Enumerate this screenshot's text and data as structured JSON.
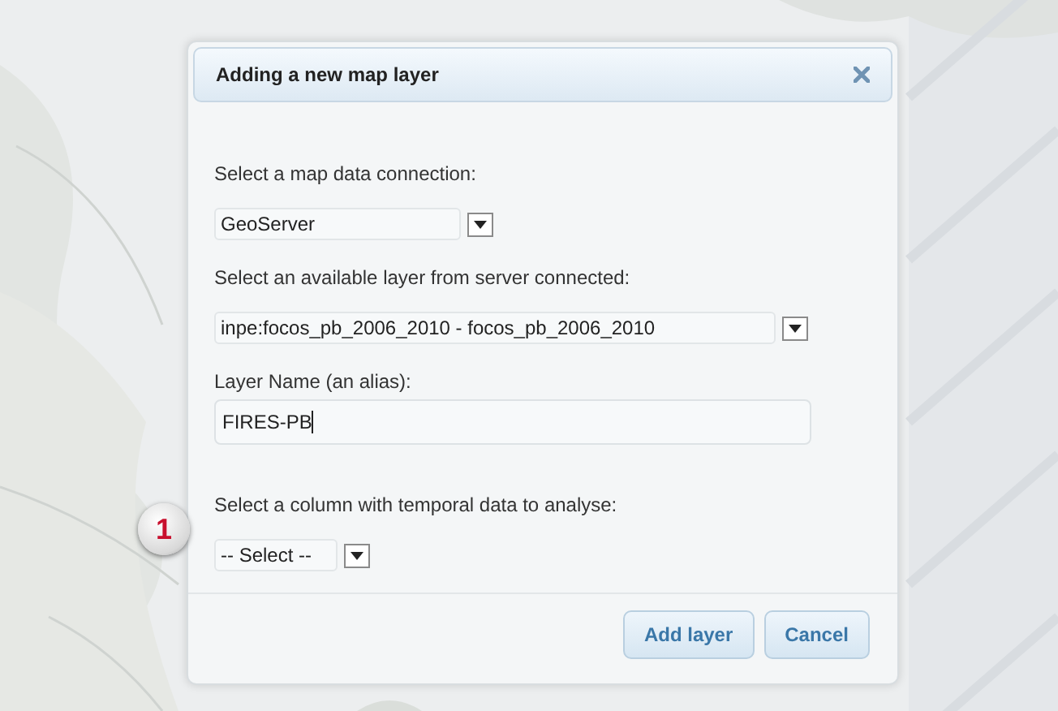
{
  "dialog": {
    "title": "Adding a new map layer",
    "fields": [
      {
        "kind": "select",
        "label": "Select a map data connection:",
        "value": "GeoServer"
      },
      {
        "kind": "select",
        "label": "Select an available layer from server connected:",
        "value": "inpe:focos_pb_2006_2010 - focos_pb_2006_2010"
      },
      {
        "kind": "text",
        "label": "Layer Name (an alias):",
        "value": "FIRES-PB"
      },
      {
        "kind": "select",
        "label": "Select a column with temporal data to analyse:",
        "value": "-- Select --",
        "callout": "1"
      }
    ],
    "buttons": [
      "Add layer",
      "Cancel"
    ]
  }
}
